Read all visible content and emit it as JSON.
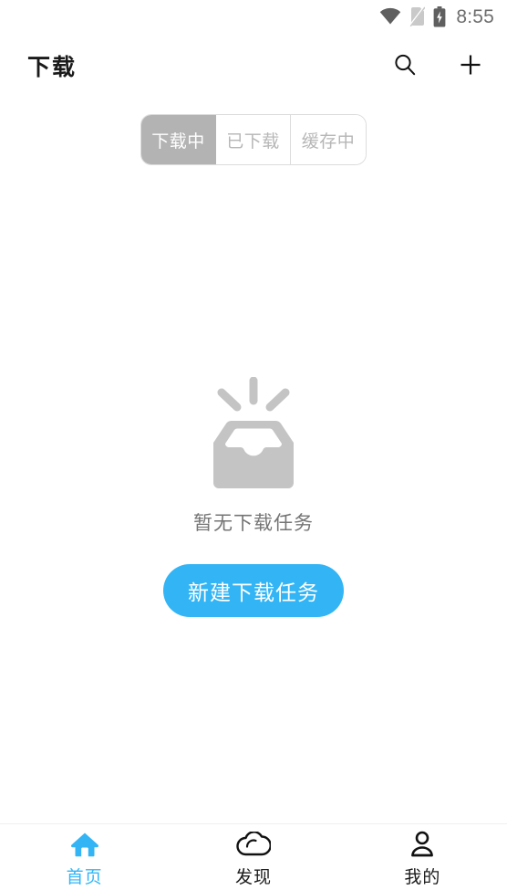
{
  "status_bar": {
    "time": "8:55",
    "icons": [
      {
        "name": "wifi-icon",
        "label": "wifi-signal-full"
      },
      {
        "name": "sim-card-off-icon",
        "label": "no-sim-card"
      },
      {
        "name": "battery-charging-icon",
        "label": "battery-charging"
      }
    ]
  },
  "header": {
    "title": "下载",
    "search_label": "search-icon",
    "add_label": "add-icon"
  },
  "tabs": {
    "items": [
      {
        "label": "下载中",
        "active": true
      },
      {
        "label": "已下载",
        "active": false
      },
      {
        "label": "缓存中",
        "active": false
      }
    ]
  },
  "empty_state": {
    "illustration": "empty-inbox-icon",
    "message": "暂无下载任务",
    "action_label": "新建下载任务"
  },
  "bottom_nav": {
    "items": [
      {
        "label": "首页",
        "icon": "home-icon",
        "active": true
      },
      {
        "label": "发现",
        "icon": "cloud-icon",
        "active": false
      },
      {
        "label": "我的",
        "icon": "person-icon",
        "active": false
      }
    ]
  },
  "colors": {
    "accent": "#33b5f5",
    "tab_active_bg": "#b3b3b3",
    "empty_gray": "#c4c4c4",
    "text_primary": "#1a1a1a",
    "text_muted": "#757575"
  }
}
